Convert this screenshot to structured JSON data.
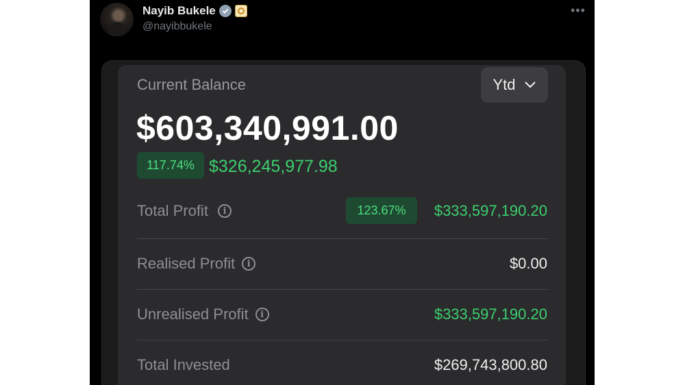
{
  "tweet": {
    "author_name": "Nayib Bukele",
    "handle": "@nayibbukele",
    "more_label": "•••"
  },
  "portfolio": {
    "current_balance_label": "Current Balance",
    "period_selector": "Ytd",
    "current_balance": "$603,340,991.00",
    "balance_change_percent": "117.74%",
    "balance_change_value": "$326,245,977.98",
    "rows": [
      {
        "label": "Total Profit",
        "percent": "123.67%",
        "value": "$333,597,190.20"
      },
      {
        "label": "Realised Profit",
        "value": "$0.00"
      },
      {
        "label": "Unrealised Profit",
        "value": "$333,597,190.20"
      },
      {
        "label": "Total Invested",
        "value": "$269,743,800.80"
      }
    ]
  },
  "icons": {
    "verified": "verified-badge-icon",
    "affiliate": "government-emblem-icon",
    "info": "info-icon",
    "chevron": "chevron-down-icon"
  },
  "colors": {
    "gain_green": "#3ccf6e",
    "gain_pill_bg": "#1f4a32",
    "card_bg": "#2b2b2d",
    "page_bg": "#000000"
  }
}
